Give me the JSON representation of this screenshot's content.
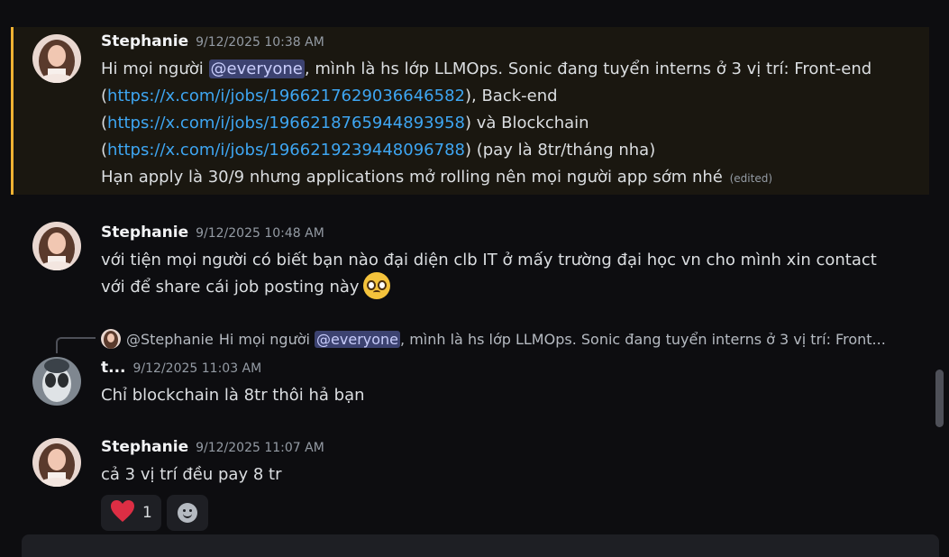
{
  "messages": [
    {
      "author": "Stephanie",
      "timestamp": "9/12/2025 10:38 AM",
      "lines": {
        "l1_pre": "Hi mọi người ",
        "mention": "@everyone",
        "l1_post": ", mình là hs lớp LLMOps. Sonic đang tuyển interns ở 3 vị trí: Front-end",
        "l2_pre": "(",
        "link1": "https://x.com/i/jobs/1966217629036646582",
        "l2_post": "), Back-end",
        "l3_pre": "(",
        "link2": "https://x.com/i/jobs/1966218765944893958",
        "l3_post": ") và Blockchain",
        "l4_pre": "(",
        "link3": "https://x.com/i/jobs/1966219239448096788",
        "l4_post": ") (pay là 8tr/tháng nha)",
        "l5": "Hạn apply là 30/9 nhưng applications mở rolling nên mọi người app sớm nhé",
        "edited": "(edited)"
      }
    },
    {
      "author": "Stephanie",
      "timestamp": "9/12/2025 10:48 AM",
      "text1": "với tiện mọi người có biết bạn nào đại diện clb IT ở mấy trường đại học vn cho mình xin contact",
      "text2": "với để share cái job posting này",
      "emoji": "pleading-face-emoji"
    },
    {
      "reply_to": {
        "author": "@Stephanie",
        "pre": "Hi mọi người ",
        "mention": "@everyone",
        "post": ", mình là hs lớp LLMOps. Sonic đang tuyển interns ở 3 vị trí: Front..."
      },
      "author": "t...",
      "timestamp": "9/12/2025 11:03 AM",
      "text": "Chỉ blockchain là 8tr thôi hả bạn"
    },
    {
      "author": "Stephanie",
      "timestamp": "9/12/2025 11:07 AM",
      "text": "cả 3 vị trí đều pay 8 tr",
      "reactions": [
        {
          "icon": "heart-icon",
          "count": "1"
        }
      ],
      "add_reaction_icon": "add-reaction-icon"
    }
  ],
  "colors": {
    "highlight_bar": "#f0b232",
    "mention_bg": "#3c4270",
    "link": "#3ea6f2",
    "background": "#0d0d10"
  }
}
